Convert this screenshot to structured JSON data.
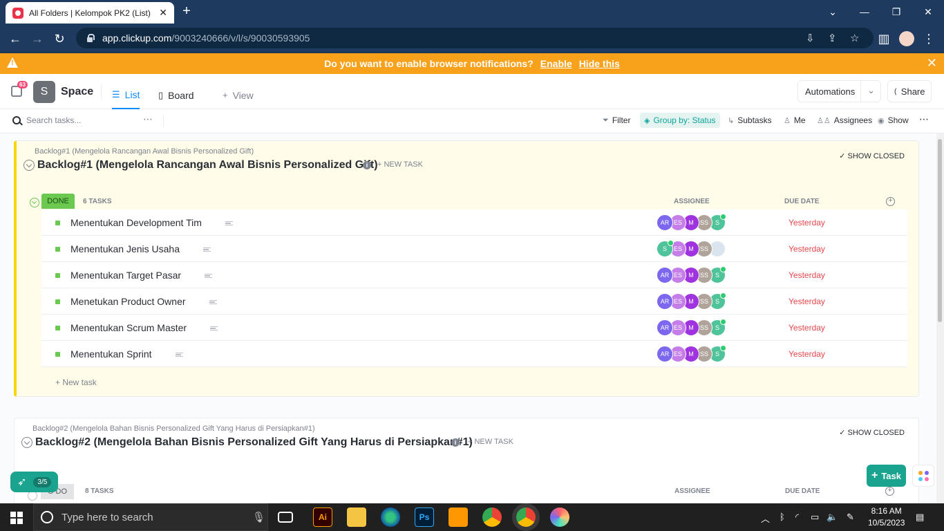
{
  "browser": {
    "tab_title": "All Folders | Kelompok PK2 (List)",
    "url_host": "app.clickup.com",
    "url_path": "/9003240666/v/l/s/90030593905"
  },
  "notification": {
    "text": "Do you want to enable browser notifications?",
    "enable": "Enable",
    "hide": "Hide this"
  },
  "header": {
    "badge": "63",
    "space_initial": "S",
    "space_name": "Space",
    "tabs": [
      "List",
      "Board",
      "View"
    ],
    "automations": "Automations",
    "share": "Share"
  },
  "toolbar": {
    "search_placeholder": "Search tasks...",
    "filter": "Filter",
    "group_by": "Group by: Status",
    "subtasks": "Subtasks",
    "me": "Me",
    "assignees": "Assignees",
    "show": "Show"
  },
  "list1": {
    "breadcrumb": "Backlog#1 (Mengelola Rancangan Awal Bisnis Personalized Gift)",
    "title": "Backlog#1 (Mengelola Rancangan Awal Bisnis Personalized Gift)",
    "new_task": "+ NEW TASK",
    "show_closed": "SHOW CLOSED",
    "status": "DONE",
    "task_count": "6 TASKS",
    "col_assignee": "ASSIGNEE",
    "col_due": "DUE DATE",
    "tasks": [
      {
        "name": "Menentukan Development Tim",
        "due": "Yesterday",
        "avatars": [
          "AR",
          "ES",
          "M",
          "SS",
          "S"
        ]
      },
      {
        "name": "Menentukan Jenis Usaha",
        "due": "Yesterday",
        "avatars": [
          "S",
          "ES",
          "M",
          "SS",
          "photo"
        ]
      },
      {
        "name": "Menentukan Target Pasar",
        "due": "Yesterday",
        "avatars": [
          "AR",
          "ES",
          "M",
          "SS",
          "S"
        ]
      },
      {
        "name": "Menetukan Product Owner",
        "due": "Yesterday",
        "avatars": [
          "AR",
          "ES",
          "M",
          "SS",
          "S"
        ]
      },
      {
        "name": "Menentukan Scrum Master",
        "due": "Yesterday",
        "avatars": [
          "AR",
          "ES",
          "M",
          "SS",
          "S"
        ]
      },
      {
        "name": "Menentukan Sprint",
        "due": "Yesterday",
        "avatars": [
          "AR",
          "ES",
          "M",
          "SS",
          "S"
        ]
      }
    ],
    "new_task_row": "+ New task"
  },
  "list2": {
    "breadcrumb": "Backlog#2 (Mengelola Bahan Bisnis Personalized Gift Yang Harus di Persiapkan#1)",
    "title": "Backlog#2 (Mengelola Bahan Bisnis Personalized Gift Yang Harus di Persiapkan#1)",
    "new_task": "+ NEW TASK",
    "show_closed": "SHOW CLOSED",
    "status": "O DO",
    "task_count": "8 TASKS",
    "col_assignee": "ASSIGNEE",
    "col_due": "DUE DATE"
  },
  "floating": {
    "task_button": "Task",
    "progress": "3/5"
  },
  "taskbar": {
    "search_placeholder": "Type here to search",
    "time": "8:16 AM",
    "date": "10/5/2023"
  },
  "colors": {
    "done_green": "#6bc950",
    "backlog_yellow": "#f7d60b",
    "accent_blue": "#0d8bff",
    "due_red": "#e5484d"
  }
}
